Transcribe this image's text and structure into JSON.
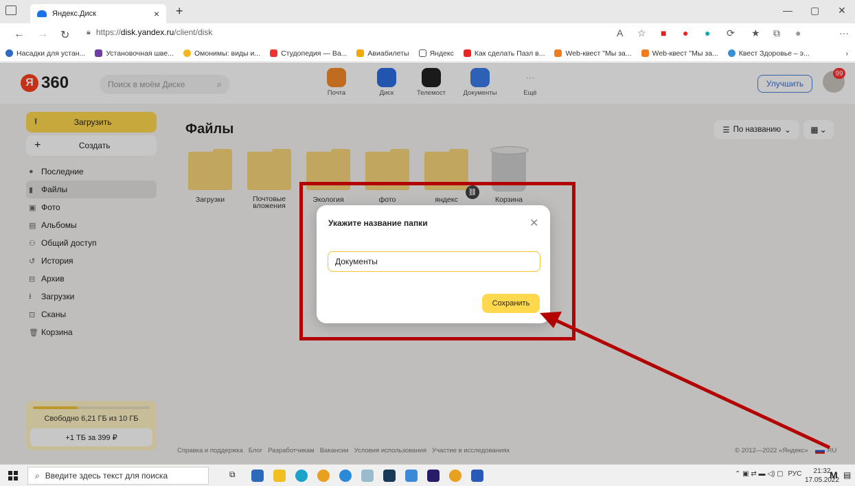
{
  "browser": {
    "tab_title": "Яндекс.Диск",
    "url_prefix": "https://",
    "url_host": "disk.yandex.ru",
    "url_path": "/client/disk",
    "bookmarks": [
      "Насадки для устан...",
      "Установочная шве...",
      "Омонимы: виды и...",
      "Студопедия — Ва...",
      "Авиабилеты",
      "Яндекс",
      "Как сделать Пазл в...",
      "Web-квест \"Мы за...",
      "Web-квест \"Мы за...",
      "Квест Здоровье – э..."
    ]
  },
  "header": {
    "logo_letter": "Я",
    "logo_text": "360",
    "search_placeholder": "Поиск в моём Диске",
    "services": [
      "Почта",
      "Диск",
      "Телемост",
      "Документы",
      "Ещё"
    ],
    "upgrade_label": "Улучшить",
    "notifications": "99"
  },
  "sidebar": {
    "upload_label": "Загрузить",
    "create_label": "Создать",
    "items": [
      {
        "label": "Последние",
        "icon": "clock-icon"
      },
      {
        "label": "Файлы",
        "icon": "file-icon"
      },
      {
        "label": "Фото",
        "icon": "photo-icon"
      },
      {
        "label": "Альбомы",
        "icon": "album-icon"
      },
      {
        "label": "Общий доступ",
        "icon": "shared-icon"
      },
      {
        "label": "История",
        "icon": "history-icon"
      },
      {
        "label": "Архив",
        "icon": "archive-icon"
      },
      {
        "label": "Загрузки",
        "icon": "download-icon"
      },
      {
        "label": "Сканы",
        "icon": "scan-icon"
      },
      {
        "label": "Корзина",
        "icon": "trash-icon"
      }
    ],
    "storage_free": "Свободно 6,21 ГБ из 10 ГБ",
    "storage_used_fraction": 0.38,
    "buy_label": "+1 ТБ за 399 ₽"
  },
  "main": {
    "title": "Файлы",
    "sort_label": "По названию",
    "folders": [
      "Загрузки",
      "Почтовые вложения",
      "Экология",
      "фото",
      "яндекс",
      "Корзина"
    ]
  },
  "footer": {
    "links": [
      "Справка и поддержка",
      "Блог",
      "Разработчикам",
      "Вакансии",
      "Условия использования",
      "Участие в исследованиях"
    ],
    "copyright": "© 2012—2022 «Яндекс»",
    "lang": "RU"
  },
  "modal": {
    "title": "Укажите название папки",
    "input_value": "Документы",
    "save_label": "Сохранить"
  },
  "taskbar": {
    "search_placeholder": "Введите здесь текст для поиска",
    "lang": "РУС",
    "time": "21:32",
    "date": "17.05.2022"
  },
  "colors": {
    "accent_yellow": "#ffd84d",
    "annotation_red": "#b30000"
  }
}
